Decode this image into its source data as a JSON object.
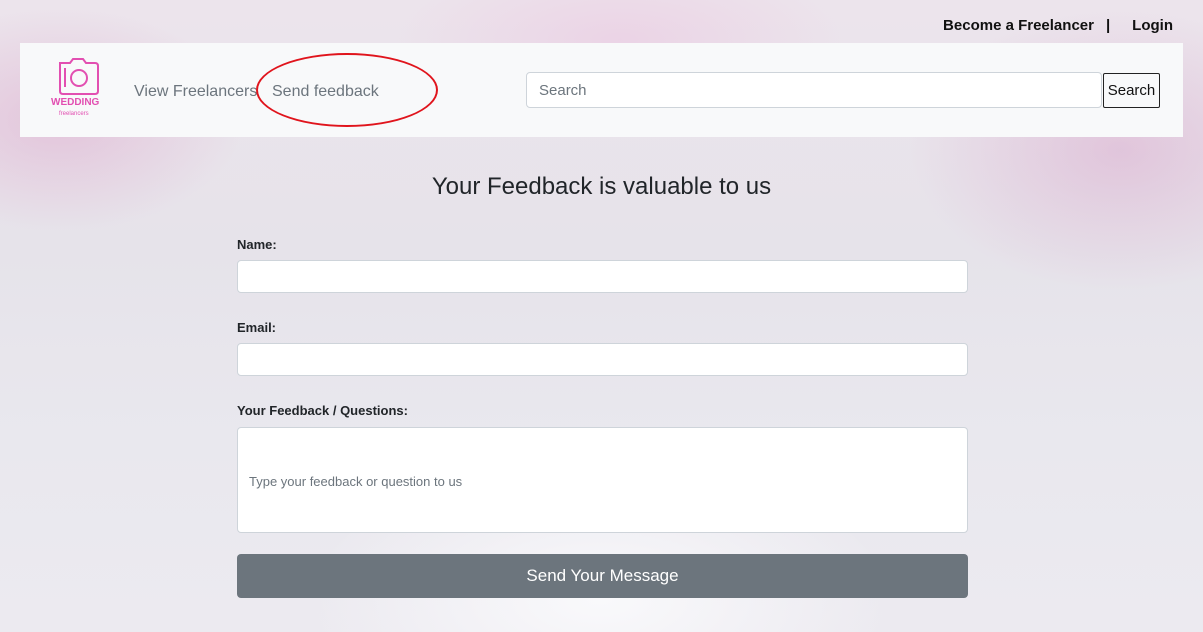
{
  "topbar": {
    "become_freelancer": "Become a Freelancer",
    "separator": "|",
    "login": "Login"
  },
  "logo": {
    "wedding": "WEDDING",
    "freelancers": "freelancers",
    "icon": "camera-icon"
  },
  "nav": {
    "view_freelancers": "View Freelancers",
    "send_feedback": "Send feedback"
  },
  "search": {
    "placeholder": "Search",
    "button_label": "Search"
  },
  "page": {
    "title": "Your Feedback is valuable to us"
  },
  "form": {
    "name_label": "Name:",
    "email_label": "Email:",
    "feedback_label": "Your Feedback / Questions:",
    "feedback_placeholder": "Type your feedback or question to us",
    "submit_label": "Send Your Message"
  },
  "colors": {
    "accent_pink": "#e24fb1",
    "highlight_circle": "#e0141c",
    "button_gray": "#6c757d"
  }
}
